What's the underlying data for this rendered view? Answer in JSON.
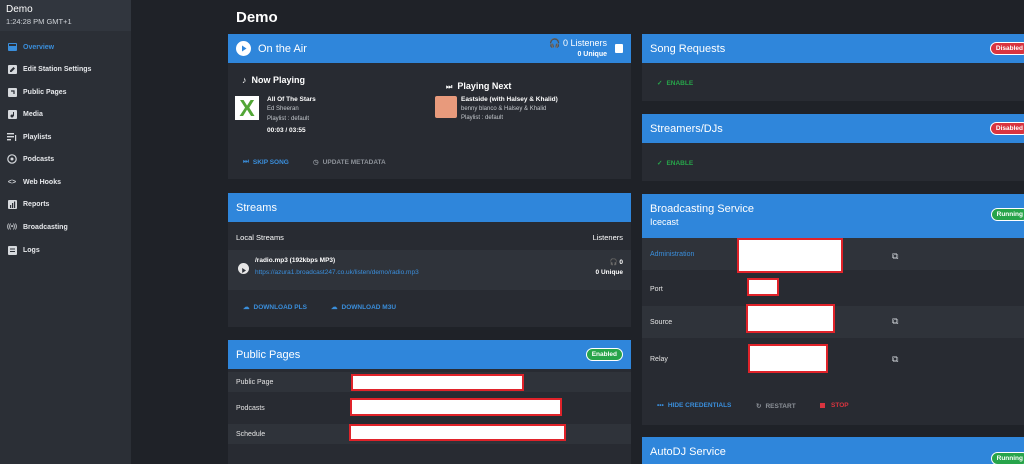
{
  "sidebar": {
    "station": "Demo",
    "time": "1:24:28 PM GMT+1",
    "items": [
      {
        "label": "Overview",
        "icon": "overview-icon"
      },
      {
        "label": "Edit Station Settings",
        "icon": "edit-icon"
      },
      {
        "label": "Public Pages",
        "icon": "public-pages-icon"
      },
      {
        "label": "Media",
        "icon": "media-icon"
      },
      {
        "label": "Playlists",
        "icon": "playlist-icon"
      },
      {
        "label": "Podcasts",
        "icon": "podcast-icon"
      },
      {
        "label": "Web Hooks",
        "icon": "code-icon"
      },
      {
        "label": "Reports",
        "icon": "reports-icon"
      },
      {
        "label": "Broadcasting",
        "icon": "broadcast-icon"
      },
      {
        "label": "Logs",
        "icon": "logs-icon"
      }
    ]
  },
  "page": {
    "title": "Demo"
  },
  "onair": {
    "title": "On the Air",
    "listeners": "0 Listeners",
    "unique": "0 Unique",
    "now": {
      "heading": "Now Playing",
      "song": "All Of The Stars",
      "artist": "Ed Sheeran",
      "playlist": "Playlist : default",
      "time": "00:03 / 03:55"
    },
    "next": {
      "heading": "Playing Next",
      "song": "Eastside (with Halsey & Khalid)",
      "artist": "benny blanco & Halsey & Khalid",
      "playlist": "Playlist : default"
    },
    "skip": "SKIP SONG",
    "update": "UPDATE METADATA"
  },
  "streams": {
    "title": "Streams",
    "local": "Local Streams",
    "listeners_hdr": "Listeners",
    "stream": {
      "name": "/radio.mp3 (192kbps MP3)",
      "url": "https://azura1.broadcast247.co.uk/listen/demo/radio.mp3",
      "count": "0",
      "unique": "0 Unique"
    },
    "pls": "DOWNLOAD PLS",
    "m3u": "DOWNLOAD M3U"
  },
  "public": {
    "title": "Public Pages",
    "badge": "Enabled",
    "rows": [
      "Public Page",
      "Podcasts",
      "Schedule"
    ]
  },
  "requests": {
    "title": "Song Requests",
    "badge": "Disabled",
    "enable": "ENABLE"
  },
  "djs": {
    "title": "Streamers/DJs",
    "badge": "Disabled",
    "enable": "ENABLE"
  },
  "broadcast": {
    "title": "Broadcasting Service",
    "sub": "Icecast",
    "badge": "Running",
    "rows": [
      "Administration",
      "Port",
      "Source",
      "Relay"
    ],
    "hide": "HIDE CREDENTIALS",
    "restart": "RESTART",
    "stop": "STOP"
  },
  "autodj": {
    "title": "AutoDJ Service",
    "badge": "Running"
  },
  "colors": {
    "accent": "#2f86db",
    "danger": "#d9343f",
    "success": "#27a44a"
  }
}
